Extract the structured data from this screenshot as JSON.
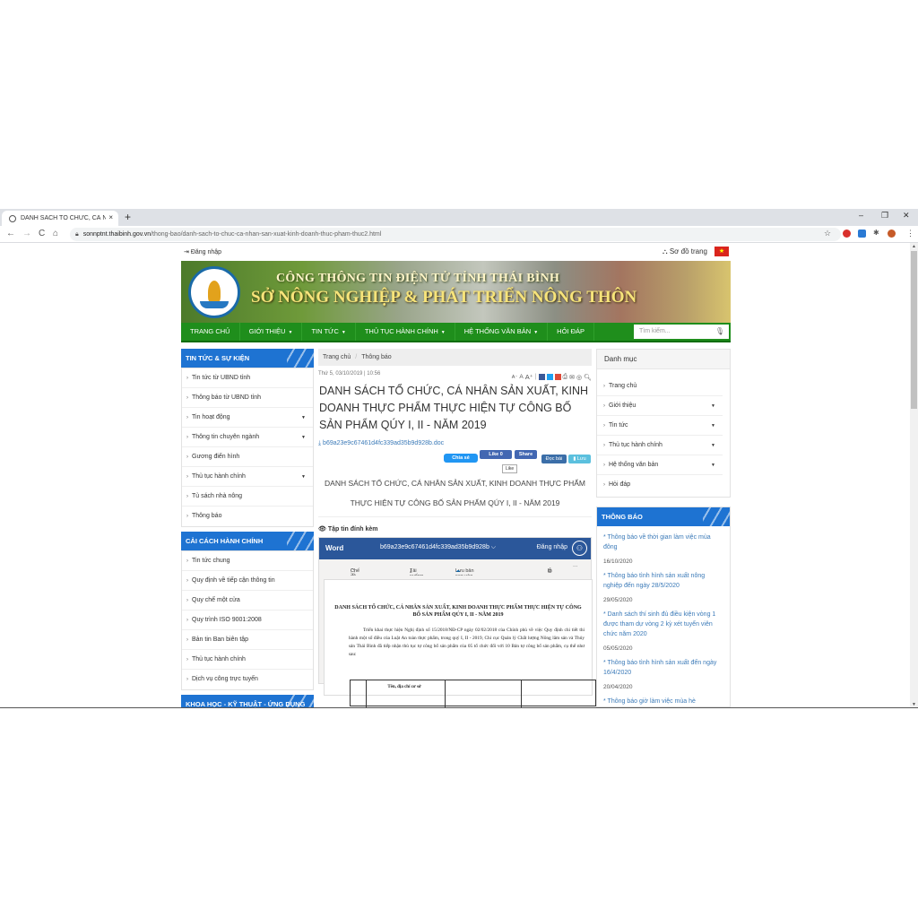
{
  "browser": {
    "tab_title": "DANH SÁCH TỔ CHỨC, CÁ NHÂ",
    "tab_close": "×",
    "new_tab": "+",
    "url_host": "sonnptnt.thaibinh.gov.vn",
    "url_path": "/thong-bao/danh-sach-to-chuc-ca-nhan-san-xuat-kinh-doanh-thuc-pham-thuc2.html",
    "back": "←",
    "forward": "→",
    "reload": "C",
    "home": "⌂",
    "star": "☆",
    "menu": "⋮",
    "minimize": "–",
    "restore": "❐",
    "close": "✕"
  },
  "topbar": {
    "login": "Đăng nhập",
    "sitemap": "Sơ đồ trang",
    "flag_star": "★"
  },
  "banner": {
    "line1": "CÔNG THÔNG TIN ĐIỆN TỬ TỈNH THÁI BÌNH",
    "line2": "SỞ NÔNG NGHIỆP & PHÁT TRIỂN NÔNG THÔN"
  },
  "nav": {
    "items": [
      {
        "label": "TRANG CHỦ",
        "dropdown": false
      },
      {
        "label": "GIỚI THIỆU",
        "dropdown": true
      },
      {
        "label": "TIN TỨC",
        "dropdown": true
      },
      {
        "label": "THỦ TỤC HÀNH CHÍNH",
        "dropdown": true
      },
      {
        "label": "HỆ THỐNG VĂN BẢN",
        "dropdown": true
      },
      {
        "label": "HỎI ĐÁP",
        "dropdown": false
      }
    ],
    "search_placeholder": "Tìm kiếm..."
  },
  "left": {
    "news": {
      "title": "TIN TỨC & SỰ KIỆN",
      "items": [
        {
          "label": "Tin tức từ UBND tỉnh",
          "dropdown": false
        },
        {
          "label": "Thông báo từ UBND tỉnh",
          "dropdown": false
        },
        {
          "label": "Tin hoạt động",
          "dropdown": true
        },
        {
          "label": "Thông tin chuyên ngành",
          "dropdown": true
        },
        {
          "label": "Gương điển hình",
          "dropdown": false
        },
        {
          "label": "Thủ tục hành chính",
          "dropdown": true
        },
        {
          "label": "Tủ sách nhà nông",
          "dropdown": false
        },
        {
          "label": "Thông báo",
          "dropdown": false
        }
      ]
    },
    "reform": {
      "title": "CẢI CÁCH HÀNH CHÍNH",
      "items": [
        {
          "label": "Tin tức chung"
        },
        {
          "label": "Quy định về tiếp cận thông tin"
        },
        {
          "label": "Quy chế một cửa"
        },
        {
          "label": "Quy trình ISO 9001:2008"
        },
        {
          "label": "Bản tin Ban biên tập"
        },
        {
          "label": "Thủ tục hành chính"
        },
        {
          "label": "Dịch vụ công trực tuyến"
        }
      ]
    },
    "science": {
      "title": "KHOA HỌC - KỸ THUẬT - ỨNG DỤNG"
    }
  },
  "article": {
    "breadcrumb": [
      "Trang chủ",
      "Thông báo"
    ],
    "datetime": "Thứ 5, 03/10/2019 | 10:56",
    "font_small": "A⁻",
    "font_normal": "A",
    "font_large": "A⁺",
    "title": "DANH SÁCH TỔ CHỨC, CÁ NHÂN SẢN XUẤT, KINH DOANH THỰC PHẨM THỰC HIỆN TỰ CÔNG BỐ SẢN PHẨM QÚY I, II - NĂM 2019",
    "doc_link": "b69a23e9c67461d4fc339ad35b9d928b.doc",
    "share_zalo": "Chia sẻ",
    "fb_like": "Like 0",
    "fb_share": "Share",
    "read": "Đọc bài",
    "save": "Lưu",
    "tooltip": "Like",
    "subtitle": "DANH SÁCH TỔ CHỨC, CÁ NHÂN SẢN XUẤT, KINH DOANH THỰC PHẨM THỰC HIỆN TỰ CÔNG BỐ SẢN PHẨM QÚY I, II - NĂM 2019",
    "attachments_label": "Tập tin đính kèm"
  },
  "word": {
    "brand": "Word",
    "filename": "b69a23e9c67461d4fc339ad35b9d928b ⌵",
    "login": "Đăng nhập",
    "tools": [
      "Chế độ Truy cập",
      "Tải xuống",
      "Lưu bản sao vào OneDrive.",
      "In",
      "···"
    ],
    "doc_title": "DANH SÁCH TỔ CHỨC, CÁ NHÂN SẢN XUẤT, KINH DOANH THỰC PHẨM THỰC HIỆN TỰ CÔNG BỐ SẢN PHẨM QÚY I, II - NĂM 2019",
    "doc_body": "Triển khai thực hiện Nghị định số 15/2018/NĐ-CP ngày 02/02/2018 của Chính phủ về việc Quy định chi tiết thi hành một số điều của Luật An toàn thực phẩm, trong quý I, II - 2019, Chi cục Quản lý Chất lượng Nông lâm sản và Thủy sản Thái Bình đã tiếp nhận thủ tục tự công bố sản phẩm của 05 tổ chức đối với 10 Bản tự công bố sản phẩm, cụ thể như sau:",
    "table_header": "Tên, địa chỉ cơ sở"
  },
  "right": {
    "menu_title": "Danh mục",
    "menu_items": [
      {
        "label": "Trang chủ",
        "dropdown": false
      },
      {
        "label": "Giới thiệu",
        "dropdown": true
      },
      {
        "label": "Tin tức",
        "dropdown": true
      },
      {
        "label": "Thủ tục hành chính",
        "dropdown": true
      },
      {
        "label": "Hệ thống văn bản",
        "dropdown": true
      },
      {
        "label": "Hỏi đáp",
        "dropdown": false
      }
    ],
    "notices_title": "THÔNG BÁO",
    "notices": [
      {
        "text": "* Thông báo về thời gian làm việc mùa đông",
        "date": "16/10/2020"
      },
      {
        "text": "* Thông báo tình hình sản xuất nông nghiệp đến ngày 28/5/2020",
        "date": "29/05/2020"
      },
      {
        "text": "* Danh sách thí sinh đủ điều kiện vòng 1 được tham dự vòng 2 kỳ xét tuyển viên chức năm 2020",
        "date": "05/05/2020"
      },
      {
        "text": "* Thông báo tình hình sản xuất đến ngày 16/4/2020",
        "date": "20/04/2020"
      },
      {
        "text": "* Thông báo giờ làm việc mùa hè",
        "date": ""
      }
    ]
  },
  "colors": {
    "nav_green": "#1f8e1c",
    "box_blue": "#1e73d2",
    "word_blue": "#2b579a",
    "link_blue": "#3b7ab8"
  }
}
